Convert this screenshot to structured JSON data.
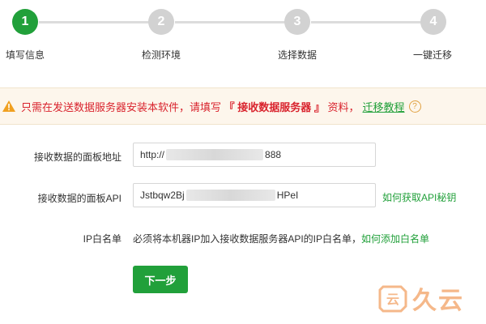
{
  "stepper": {
    "steps": [
      {
        "number": "1",
        "label": "填写信息",
        "active": true
      },
      {
        "number": "2",
        "label": "检测环境",
        "active": false
      },
      {
        "number": "3",
        "label": "选择数据",
        "active": false
      },
      {
        "number": "4",
        "label": "一键迁移",
        "active": false
      }
    ]
  },
  "warning": {
    "text_before": "只需在发送数据服务器安装本软件，请填写",
    "highlight": "『 接收数据服务器 』",
    "text_after": "资料，",
    "link": "迁移教程",
    "help_icon_glyph": "?"
  },
  "form": {
    "panel_address_label": "接收数据的面板地址",
    "panel_address_prefix": "http://",
    "panel_address_suffix": "888",
    "panel_api_label": "接收数据的面板API",
    "panel_api_prefix": "Jstbqw2Bj",
    "panel_api_suffix": "HPeI",
    "api_help_link": "如何获取API秘钥",
    "whitelist_label": "IP白名单",
    "whitelist_text": "必须将本机器IP加入接收数据服务器API的IP白名单，",
    "whitelist_link": "如何添加白名单",
    "next_button": "下一步"
  },
  "watermark": {
    "text": "久云",
    "logo_glyph": "云"
  },
  "colors": {
    "primary": "#21a03a",
    "warning_text": "#d9232d",
    "inactive_step": "#d2d2d2"
  }
}
